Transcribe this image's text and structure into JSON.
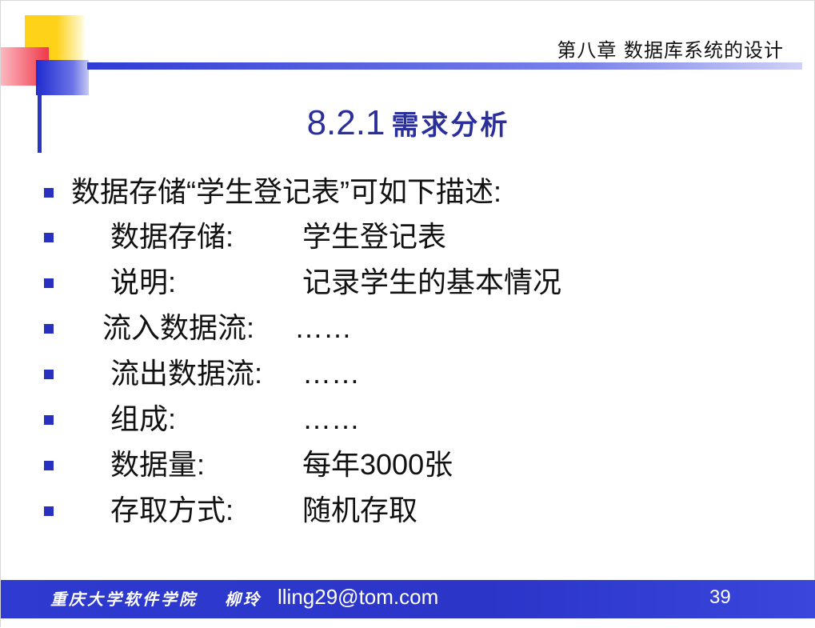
{
  "header": {
    "chapter_title": "第八章 数据库系统的设计"
  },
  "section": {
    "number": "8.2.1",
    "title": "需求分析"
  },
  "bullets": [
    {
      "label": "数据存储“学生登记表”可如下描述:",
      "value": ""
    },
    {
      "label": "数据存储:",
      "value": "学生登记表"
    },
    {
      "label": "说明:",
      "value": "记录学生的基本情况"
    },
    {
      "label": "流入数据流:",
      "value": "……"
    },
    {
      "label": "流出数据流:",
      "value": "……"
    },
    {
      "label": "组成:",
      "value": "……"
    },
    {
      "label": "数据量:",
      "value": "每年3000张"
    },
    {
      "label": "存取方式:",
      "value": "随机存取"
    }
  ],
  "footer": {
    "school": "重庆大学软件学院",
    "author": "柳玲",
    "email": "lling29@tom.com",
    "page_number": "39"
  },
  "colors": {
    "accent_blue": "#2b35c6",
    "title_blue": "#2b2f9a",
    "yellow": "#ffd21a",
    "red": "#f0384a"
  }
}
